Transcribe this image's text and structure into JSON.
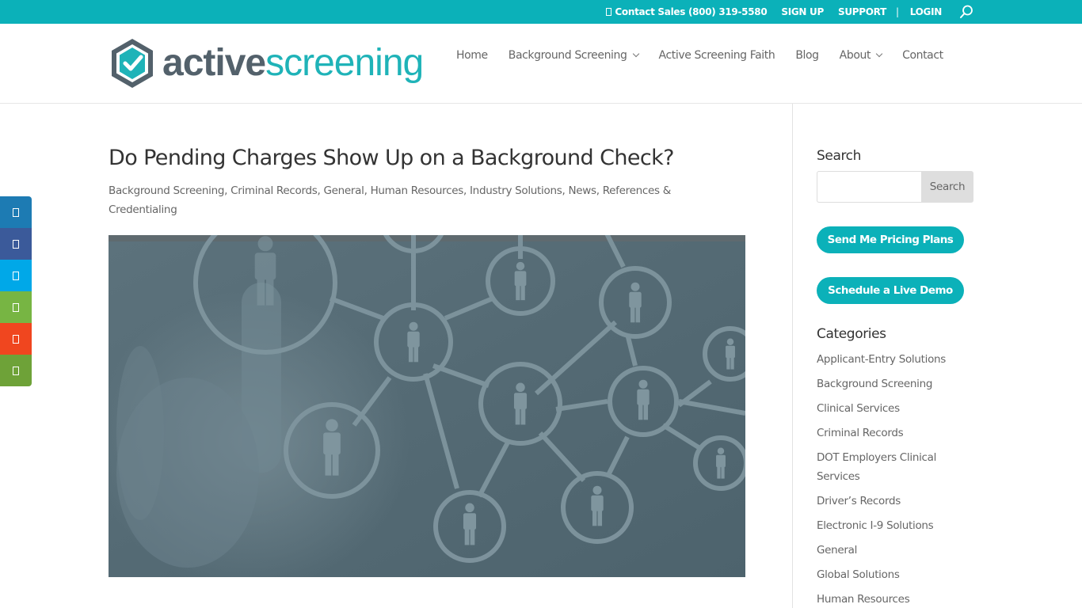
{
  "topbar": {
    "contact_label": "Contact Sales (800) 319-5580",
    "signup_label": "SIGN UP",
    "support_label": "SUPPORT",
    "separator": "|",
    "login_label": "LOGIN",
    "search_icon": "search-icon",
    "background_color": "#0bb1b9"
  },
  "header": {
    "logo_word_1": "active",
    "logo_word_2": "screening",
    "nav": [
      {
        "label": "Home",
        "has_dropdown": false
      },
      {
        "label": "Background Screening",
        "has_dropdown": true
      },
      {
        "label": "Active Screening Faith",
        "has_dropdown": false
      },
      {
        "label": "Blog",
        "has_dropdown": false
      },
      {
        "label": "About",
        "has_dropdown": true
      },
      {
        "label": "Contact",
        "has_dropdown": false
      }
    ]
  },
  "post": {
    "title": "Do Pending Charges Show Up on a Background Check?",
    "categories": [
      "Background Screening",
      "Criminal Records",
      "General",
      "Human Resources",
      "Industry Solutions",
      "News",
      "References & Credentialing"
    ],
    "featured_image_alt": "Hand touching a network of people icons"
  },
  "social": [
    {
      "name": "linkedin",
      "color": "#1d7bb3"
    },
    {
      "name": "facebook",
      "color": "#3b5a9a"
    },
    {
      "name": "twitter",
      "color": "#00a8e8"
    },
    {
      "name": "share",
      "color": "#77b543"
    },
    {
      "name": "email",
      "color": "#f0461f"
    },
    {
      "name": "more",
      "color": "#6ea238"
    }
  ],
  "sidebar": {
    "search_title": "Search",
    "search_placeholder": "",
    "search_value": "",
    "search_button": "Search",
    "pricing_button": "Send Me Pricing Plans",
    "demo_button": "Schedule a Live Demo",
    "categories_title": "Categories",
    "categories": [
      "Applicant-Entry Solutions",
      "Background Screening",
      "Clinical Services",
      "Criminal Records",
      "DOT Employers Clinical Services",
      "Driver’s Records",
      "Electronic I-9 Solutions",
      "General",
      "Global Solutions",
      "Human Resources"
    ]
  }
}
